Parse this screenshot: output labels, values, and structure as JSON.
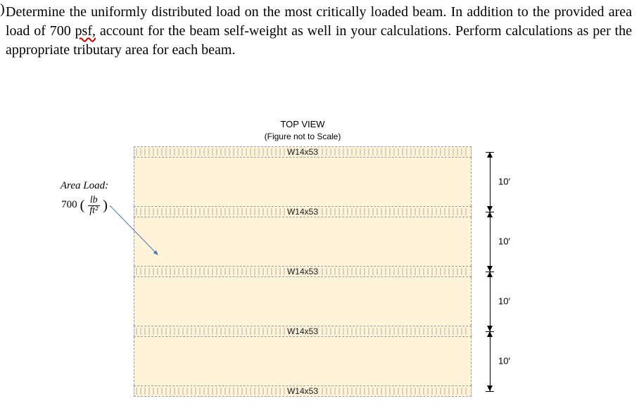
{
  "question": {
    "bracket": ")",
    "text_parts": {
      "p1": "Determine the uniformly distributed load on the most critically loaded beam. In addition to the provided area load of 700 ",
      "typo": "psf,",
      "p2": " account for the beam self-weight as well in your calculations. Perform calculations as per the appropriate tributary area for each beam."
    }
  },
  "figure": {
    "title_line1": "TOP VIEW",
    "title_line2": "(Figure not to Scale)",
    "beam_label": "W14x53",
    "spacings": [
      "10′",
      "10′",
      "10′",
      "10′"
    ]
  },
  "area_load": {
    "title": "Area Load:",
    "value": "700",
    "unit_num": "lb",
    "unit_den": "ft²",
    "open": "(",
    "close": ")"
  }
}
